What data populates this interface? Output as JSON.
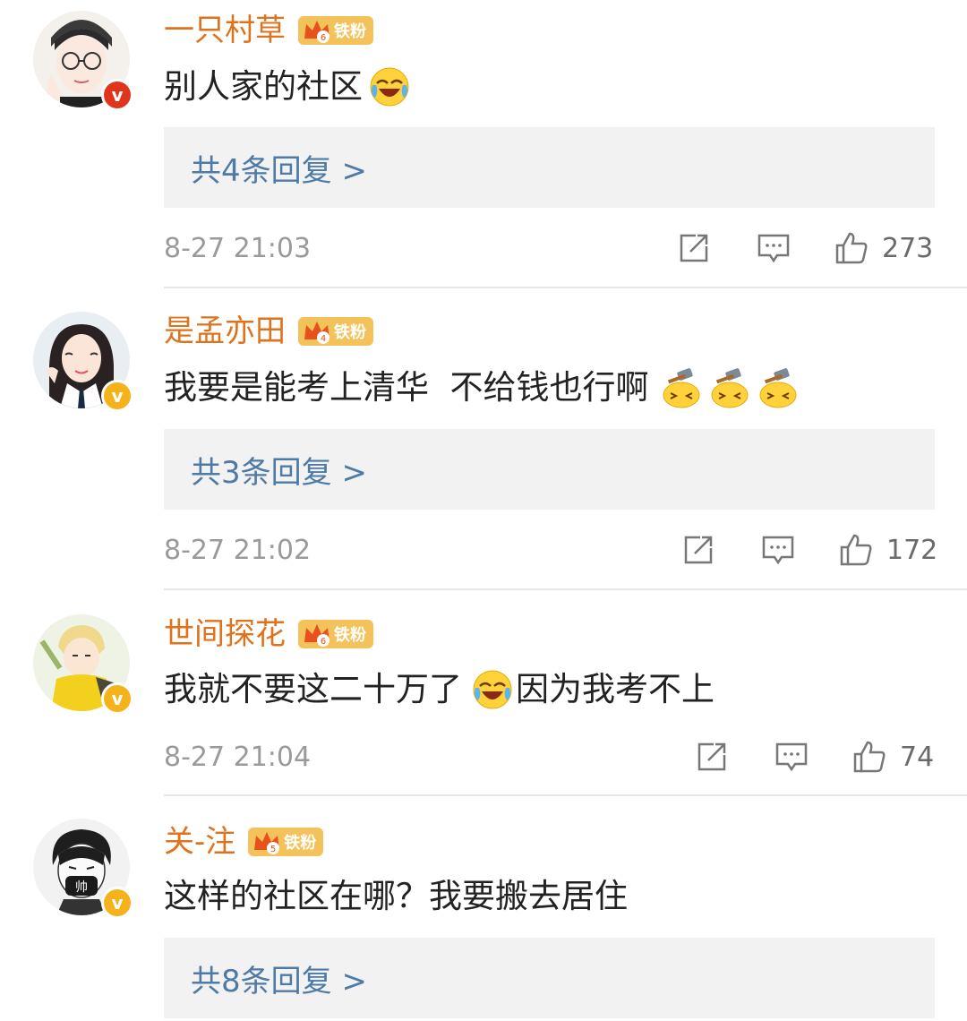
{
  "comments": [
    {
      "username": "一只村草",
      "fan_level": "6",
      "fan_badge": "铁粉",
      "verify": "red",
      "text": "别人家的社区",
      "trailing_text": "",
      "emojis": [
        "laugh-cry-emoji"
      ],
      "replies_label": "共4条回复 >",
      "timestamp": "8-27 21:03",
      "likes": "273"
    },
    {
      "username": "是孟亦田",
      "fan_level": "4",
      "fan_badge": "铁粉",
      "verify": "gold",
      "text": "我要是能考上清华  不给钱也行啊",
      "trailing_text": "",
      "emojis": [
        "hammer-emoji",
        "hammer-emoji",
        "hammer-emoji"
      ],
      "replies_label": "共3条回复 >",
      "timestamp": "8-27 21:02",
      "likes": "172"
    },
    {
      "username": "世间探花",
      "fan_level": "6",
      "fan_badge": "铁粉",
      "verify": "gold",
      "text": "我就不要这二十万了",
      "trailing_text": "因为我考不上",
      "emojis": [
        "laugh-cry-emoji"
      ],
      "replies_label": "",
      "timestamp": "8-27 21:04",
      "likes": "74"
    },
    {
      "username": "关-注",
      "fan_level": "5",
      "fan_badge": "铁粉",
      "verify": "gold",
      "text": "这样的社区在哪？我要搬去居住",
      "trailing_text": "",
      "emojis": [],
      "replies_label": "共8条回复 >",
      "timestamp": "",
      "likes": ""
    }
  ],
  "icons": {
    "share": "share-icon",
    "comment": "comment-icon",
    "like": "thumbs-up-icon"
  },
  "colors": {
    "username": "#e0721c",
    "reply_link": "#4e7aa6",
    "reply_bg": "#f2f2f2",
    "badge": "#f3c25b",
    "verify_red": "#e0351a",
    "verify_gold": "#f6b21a"
  }
}
